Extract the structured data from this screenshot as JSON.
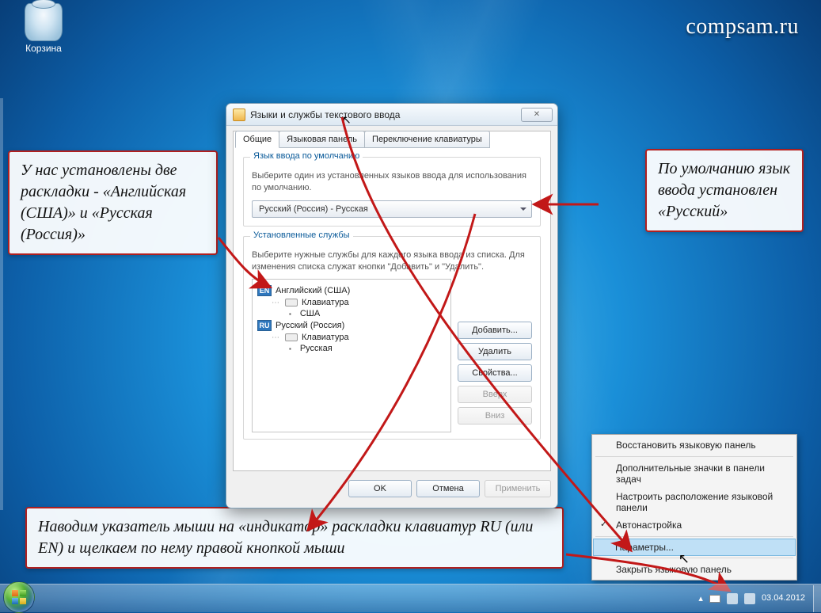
{
  "watermark": "compsam.ru",
  "desktop": {
    "recycle_bin": "Корзина"
  },
  "annotations": {
    "a1": "У нас установлены две раскладки - «Английская (США)» и «Русская (Россия)»",
    "a2": "По умолчанию язык ввода установлен «Русский»",
    "a3": "Наводим указатель мыши на «индикатор» раскладки клавиатур RU (или EN) и щелкаем по нему правой кнопкой мыши"
  },
  "dialog": {
    "title": "Языки и службы текстового ввода",
    "tabs": [
      "Общие",
      "Языковая панель",
      "Переключение клавиатуры"
    ],
    "group1": {
      "legend": "Язык ввода по умолчанию",
      "hint": "Выберите один из установленных языков ввода для использования по умолчанию.",
      "combo": "Русский (Россия) - Русская"
    },
    "group2": {
      "legend": "Установленные службы",
      "hint": "Выберите нужные службы для каждого языка ввода из списка. Для изменения списка служат кнопки \"Добавить\" и \"Удалить\".",
      "tree": {
        "en_icon": "EN",
        "en_name": "Английский (США)",
        "kbd_label": "Клавиатура",
        "en_layout": "США",
        "ru_icon": "RU",
        "ru_name": "Русский (Россия)",
        "ru_layout": "Русская"
      },
      "buttons": {
        "add": "Добавить...",
        "remove": "Удалить",
        "props": "Свойства...",
        "up": "Вверх",
        "down": "Вниз"
      }
    },
    "footer": {
      "ok": "OK",
      "cancel": "Отмена",
      "apply": "Применить"
    }
  },
  "context_menu": {
    "items": [
      "Восстановить языковую панель",
      "Дополнительные значки в панели задач",
      "Настроить расположение языковой панели",
      "Автонастройка",
      "Параметры...",
      "Закрыть языковую панель"
    ]
  },
  "taskbar": {
    "date": "03.04.2012"
  }
}
